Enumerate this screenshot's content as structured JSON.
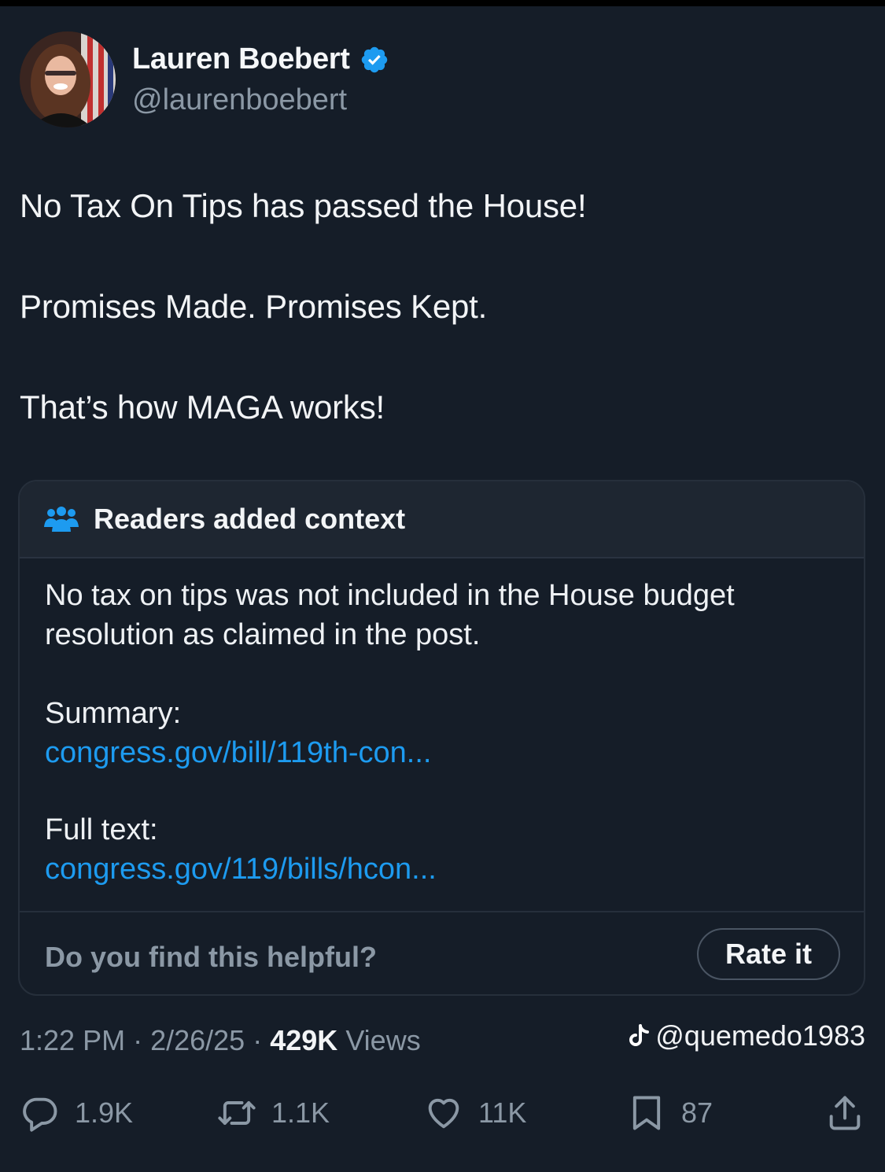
{
  "author": {
    "display_name": "Lauren Boebert",
    "handle": "@laurenboebert",
    "verified": true,
    "verified_color": "#1d9bf0"
  },
  "post": {
    "lines": [
      "No Tax On Tips has passed the House!",
      "Promises Made. Promises Kept.",
      "That’s how MAGA works!"
    ]
  },
  "community_note": {
    "title": "Readers added context",
    "icon": "people-icon",
    "text": "No tax on tips was not included in the House budget resolution as claimed in the post.",
    "summary_label": "Summary:",
    "summary_link": "congress.gov/bill/119th-con...",
    "full_text_label": "Full text:",
    "full_text_link": "congress.gov/119/bills/hcon...",
    "helpful_prompt": "Do you find this helpful?",
    "rate_button": "Rate it",
    "link_color": "#1d9bf0"
  },
  "meta": {
    "time": "1:22 PM",
    "date": "2/26/25",
    "views_count": "429K",
    "views_label": "Views"
  },
  "watermark": {
    "icon": "tiktok-icon",
    "text": "@quemedo1983"
  },
  "actions": {
    "replies": "1.9K",
    "reposts": "1.1K",
    "likes": "11K",
    "bookmarks": "87"
  }
}
